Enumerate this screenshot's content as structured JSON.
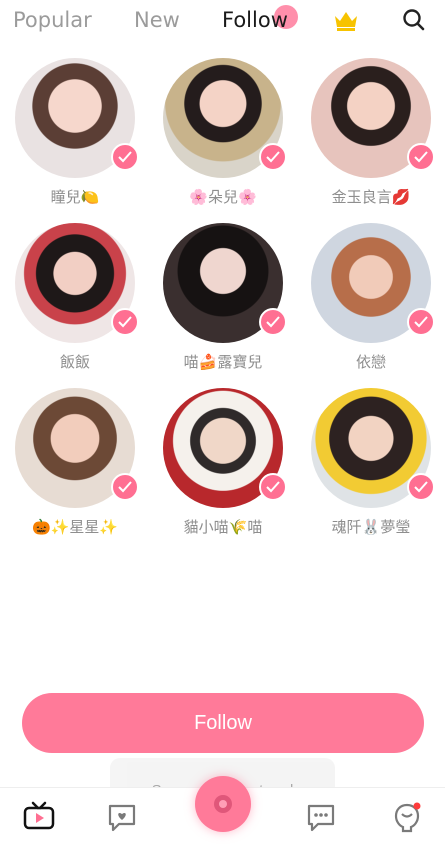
{
  "tabs": {
    "popular": "Popular",
    "new": "New",
    "follow": "Follow"
  },
  "icons": {
    "crown": "crown-icon",
    "search": "search-icon"
  },
  "users": [
    {
      "name": "瞳兒🍋"
    },
    {
      "name": "🌸朵兒🌸"
    },
    {
      "name": "金玉良言💋"
    },
    {
      "name": "飯飯"
    },
    {
      "name": "喵🍰露寶兒"
    },
    {
      "name": "依戀"
    },
    {
      "name": "🎃✨星星✨"
    },
    {
      "name": "貓小喵🌾喵"
    },
    {
      "name": "魂阡🐰夢瑩"
    }
  ],
  "follow_button": {
    "label": "Follow"
  },
  "toast": {
    "text": "Screenshot Captured"
  },
  "colors": {
    "accent": "#ff7a99",
    "check": "#ff6f92",
    "tab_inactive": "#9b9b9b",
    "tab_active": "#1a1a1a"
  }
}
